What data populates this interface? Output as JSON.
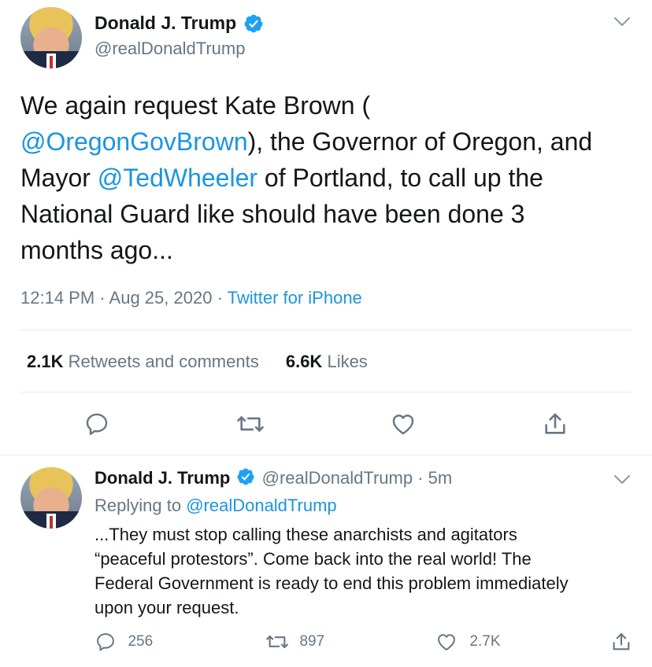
{
  "main_tweet": {
    "display_name": "Donald J. Trump",
    "handle": "@realDonaldTrump",
    "text_parts": {
      "p1": "We again request Kate Brown (",
      "mention1": "@OregonGovBrown",
      "p2": "), the Governor of Oregon, and",
      "p3": "Mayor ",
      "mention2": "@TedWheeler",
      "p4": " of Portland, to call up the",
      "p5": "National Guard like should have been done 3",
      "p6": "months ago..."
    },
    "time": "12:14 PM",
    "sep1": "·",
    "date": "Aug 25, 2020",
    "sep2": "·",
    "source": "Twitter for iPhone",
    "retweets_count": "2.1K",
    "retweets_label": "Retweets and comments",
    "likes_count": "6.6K",
    "likes_label": "Likes"
  },
  "reply_tweet": {
    "display_name": "Donald J. Trump",
    "handle": "@realDonaldTrump",
    "sep": "·",
    "age": "5m",
    "replying_prefix": "Replying to ",
    "replying_handle": "@realDonaldTrump",
    "lines": [
      "...They must stop calling these anarchists and agitators",
      "“peaceful protestors”. Come back into the real world! The",
      "Federal Government is ready to end this problem immediately",
      "upon your request."
    ],
    "reply_count": "256",
    "retweet_count": "897",
    "like_count": "2.7K"
  },
  "colors": {
    "link": "#1b95e0",
    "muted": "#657786",
    "verified": "#1da1f2",
    "divider": "#e6ecf0"
  },
  "icons": [
    "verified-badge-icon",
    "chevron-down-icon",
    "reply-icon",
    "retweet-icon",
    "like-icon",
    "share-icon"
  ]
}
